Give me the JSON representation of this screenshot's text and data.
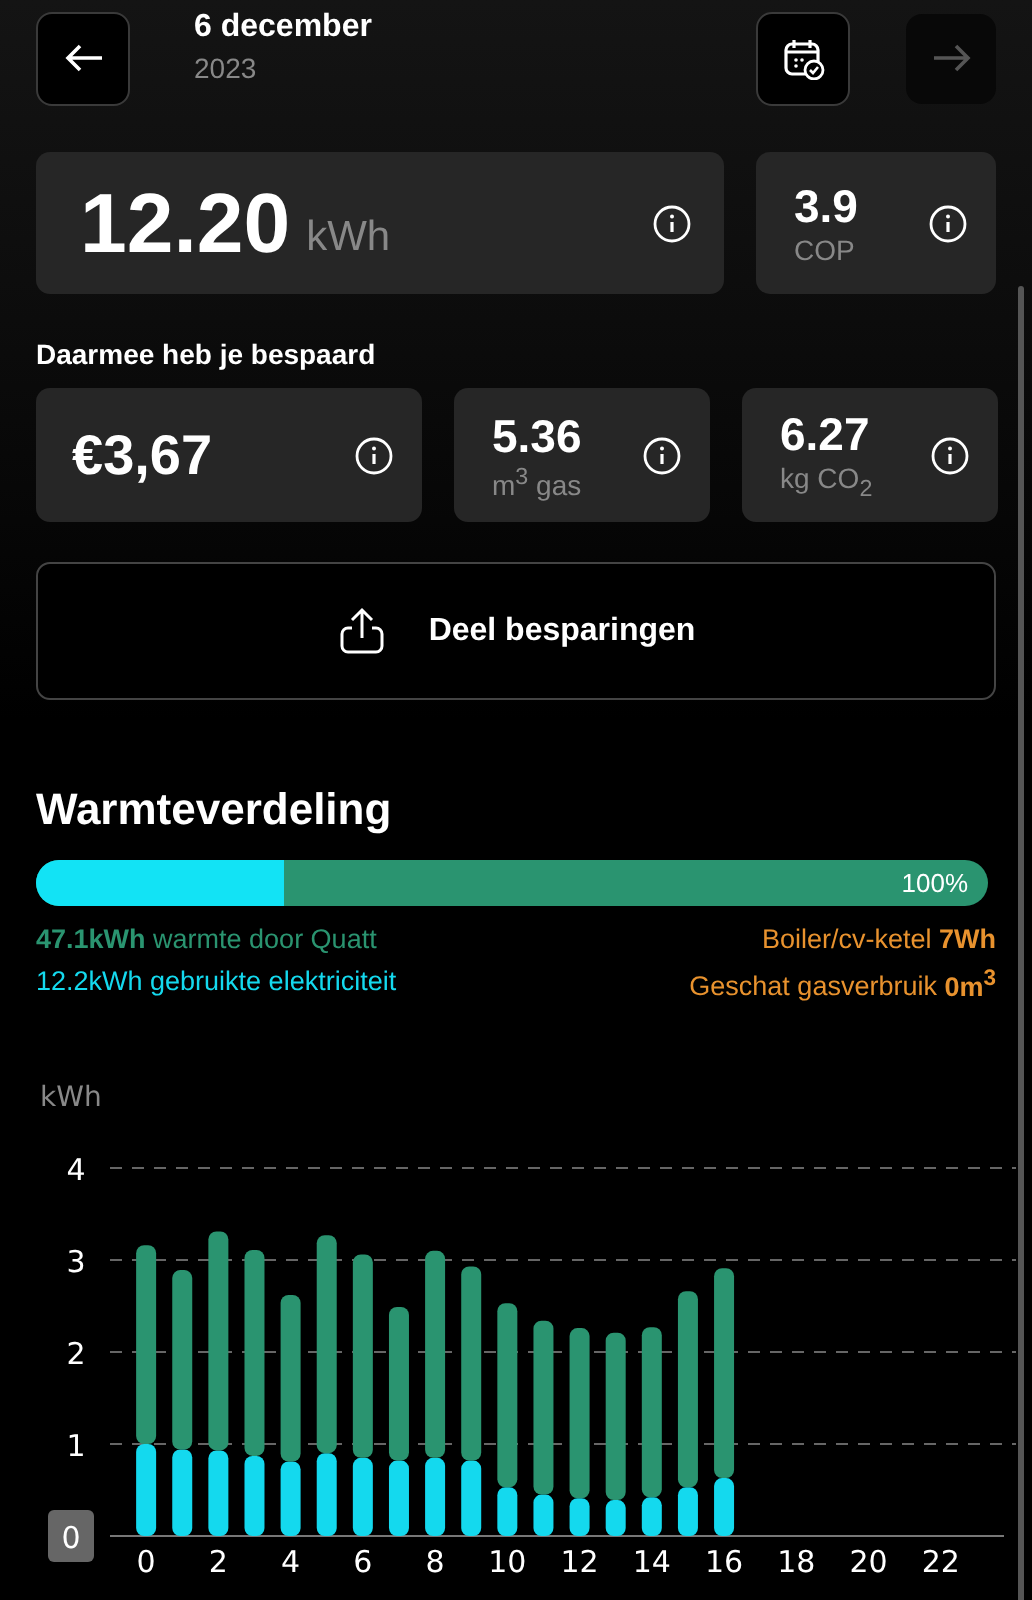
{
  "header": {
    "title": "6 december",
    "subtitle": "2023",
    "forward_button": {
      "disabled": true
    }
  },
  "energy_card": {
    "value": "12.20",
    "unit": "kWh"
  },
  "cop_card": {
    "value": "3.9",
    "unit": "COP"
  },
  "savings_label": "Daarmee heb je bespaard",
  "savings": [
    {
      "value": "€3,67"
    },
    {
      "value": "5.36",
      "unit": "m$^{3}$ gas"
    },
    {
      "value": "6.27",
      "unit": "kg CO$_{2}$"
    }
  ],
  "share_button": "Deel besparingen",
  "heat_distribution": {
    "title": "Warmteverdeling",
    "level": 0.26,
    "percent": "100%",
    "legend_left": [
      {
        "text": "**47.1kWh** warmte door Quatt",
        "color": "#2a9470"
      },
      {
        "text": "12.2kWh gebruikte elektriciteit",
        "color": "#14d9ee"
      }
    ],
    "legend_right": [
      {
        "text": "Boiler/cv-ketel **7Wh**",
        "color": "#e8922e"
      },
      {
        "text": "Geschat gasverbruik **0m$^{3}$**",
        "color": "#e8922e"
      }
    ]
  },
  "chart_data": {
    "type": "bar",
    "stacked": true,
    "ylabel": "kWh",
    "x": [
      0,
      1,
      2,
      3,
      4,
      5,
      6,
      7,
      8,
      9,
      10,
      11,
      12,
      13,
      14,
      15,
      16
    ],
    "series": [
      {
        "color": "#14d9ee",
        "values": [
          1.0,
          0.94,
          0.93,
          0.87,
          0.81,
          0.9,
          0.85,
          0.82,
          0.85,
          0.82,
          0.53,
          0.45,
          0.41,
          0.39,
          0.42,
          0.53,
          0.63
        ]
      },
      {
        "color": "#2a9470",
        "values": [
          2.16,
          1.95,
          2.38,
          2.24,
          1.81,
          2.37,
          2.21,
          1.67,
          2.25,
          2.11,
          2.0,
          1.89,
          1.85,
          1.82,
          1.85,
          2.13,
          2.28
        ]
      }
    ],
    "xlim": [
      -1,
      23.75
    ],
    "ylim": [
      0,
      4
    ],
    "grid": true,
    "xticks": [
      0,
      2,
      4,
      6,
      8,
      10,
      12,
      14,
      16,
      18,
      20,
      22
    ],
    "yticks": [
      0,
      1,
      2,
      3,
      4
    ]
  }
}
